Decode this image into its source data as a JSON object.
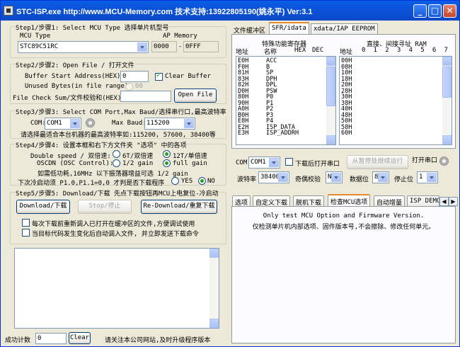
{
  "window": {
    "title": "STC-ISP.exe  http://www.MCU-Memory.com  技术支持:13922805190(姚永平)  Ver:3.1",
    "min_label": "_",
    "max_label": "□",
    "close_label": "✕"
  },
  "step1": {
    "title": "Step1/步骤1: Select MCU Type  选择单片机型号",
    "mcu_type_label": "MCU Type",
    "ap_memory_label": "AP Memory",
    "mcu_value": "STC89C51RC",
    "ap_start": "0000",
    "ap_dash": "-",
    "ap_end": "0FFF"
  },
  "step2": {
    "title": "Step2/步骤2: Open File / 打开文件",
    "buffer_label": "Buffer Start Address(HEX):",
    "buffer_value": "0",
    "clear_buffer_label": "Clear Buffer",
    "unused_label": "Unused Bytes(in file range):",
    "unused_value": "00",
    "checksum_label": "File Check Sum/文件校验和(HEX):",
    "checksum_value": "",
    "open_file_label": "Open File"
  },
  "step3": {
    "title": "Step3/步骤3: Select COM Port,Max Baud/选择串行口,最高波特率",
    "com_label": "COM:",
    "com_value": "COM1",
    "max_baud_label": "Max Baud:",
    "max_baud_value": "115200",
    "hint": "请选择最适合本台机器的最高波特率如:115200, 57600, 38400等"
  },
  "step4": {
    "title": "Step4/步骤4: 设置本框和右下方文件夹 \"选项\" 中的各项",
    "double_speed_label": "Double speed / 双倍速:",
    "opt_6t": "6T/双倍速",
    "opt_12t": "12T/单倍速",
    "oscdn_label": "OSCDN (OSC Control):",
    "opt_half": "1/2 gain",
    "opt_full": "full gain",
    "gain_note": "如需低功耗,16MHz 以下振荡器增益可选 1/2 gain",
    "next_label": "下次冷启动须 P1.0,P1.1=0,0 才判是否下载程序",
    "opt_yes": "YES",
    "opt_no": "NO"
  },
  "step5": {
    "title": "Step5/步骤5: Download/下载  先点下载按钮再MCU上电复位-冷启动",
    "download_label": "Download/下载",
    "stop_label": "Stop/停止",
    "redownload_label": "Re-Download/重复下载",
    "reload_label": "每次下载前重新调入已打开在缓冲区的文件,方便调试使用",
    "auto_label": "当目标代码发生变化后自动调入文件, 并立即发送下载命令"
  },
  "footer": {
    "success_label": "成功计数",
    "success_value": "0",
    "clear_label": "Clear",
    "notice": "请关注本公司网站,及时升级程序版本"
  },
  "top_tabs": {
    "buffer_label": "文件缓冲区",
    "sfr_label": "SFR/idata",
    "xdata_label": "xdata/IAP EEPROM"
  },
  "sfr": {
    "title": "特殊功能寄存器",
    "col_addr": "地址",
    "col_name": "名称",
    "col_hex": "HEX",
    "col_dec": "DEC",
    "rows": [
      [
        "E0H",
        "ACC"
      ],
      [
        "F0H",
        "B"
      ],
      [
        "81H",
        "SP"
      ],
      [
        "83H",
        "DPH"
      ],
      [
        "82H",
        "DPL"
      ],
      [
        "D0H",
        "PSW"
      ],
      [
        "80H",
        "P0"
      ],
      [
        "90H",
        "P1"
      ],
      [
        "A0H",
        "P2"
      ],
      [
        "B0H",
        "P3"
      ],
      [
        "E8H",
        "P4"
      ],
      [
        "E2H",
        "ISP_DATA"
      ],
      [
        "E3H",
        "ISP_ADDRH"
      ]
    ]
  },
  "ram": {
    "title": "直接、间接寻址 RAM",
    "col_addr": "地址",
    "cols": [
      "0",
      "1",
      "2",
      "3",
      "4",
      "5",
      "6",
      "7"
    ],
    "rows": [
      "00H",
      "08H",
      "10H",
      "18H",
      "20H",
      "28H",
      "30H",
      "38H",
      "40H",
      "48H",
      "50H",
      "58H",
      "60H"
    ]
  },
  "comm": {
    "com_label": "COM",
    "com_value": "COM1",
    "open_after_label": "下载后打开串口",
    "pause_label": "从暂停处继续运行",
    "open_port_label": "打开串口",
    "baud_label": "波特率",
    "baud_value": "38400",
    "parity_label": "奇偶校验",
    "parity_value": "N",
    "databits_label": "数据位",
    "databits_value": "8",
    "stopbits_label": "停止位",
    "stopbits_value": "1"
  },
  "bottom_tabs": {
    "items": [
      "选项",
      "自定义下载",
      "脱机下载",
      "检查MCU选项",
      "自动增量",
      "ISP DEMO"
    ],
    "active_index": 3,
    "scroll_left": "◀",
    "scroll_right": "▶"
  },
  "check_mcu": {
    "line1": "Only test MCU Option and Firmware Version.",
    "line2": "仅检测单片机内部选项、固件版本号,不会擦除、修改任何单元。"
  }
}
